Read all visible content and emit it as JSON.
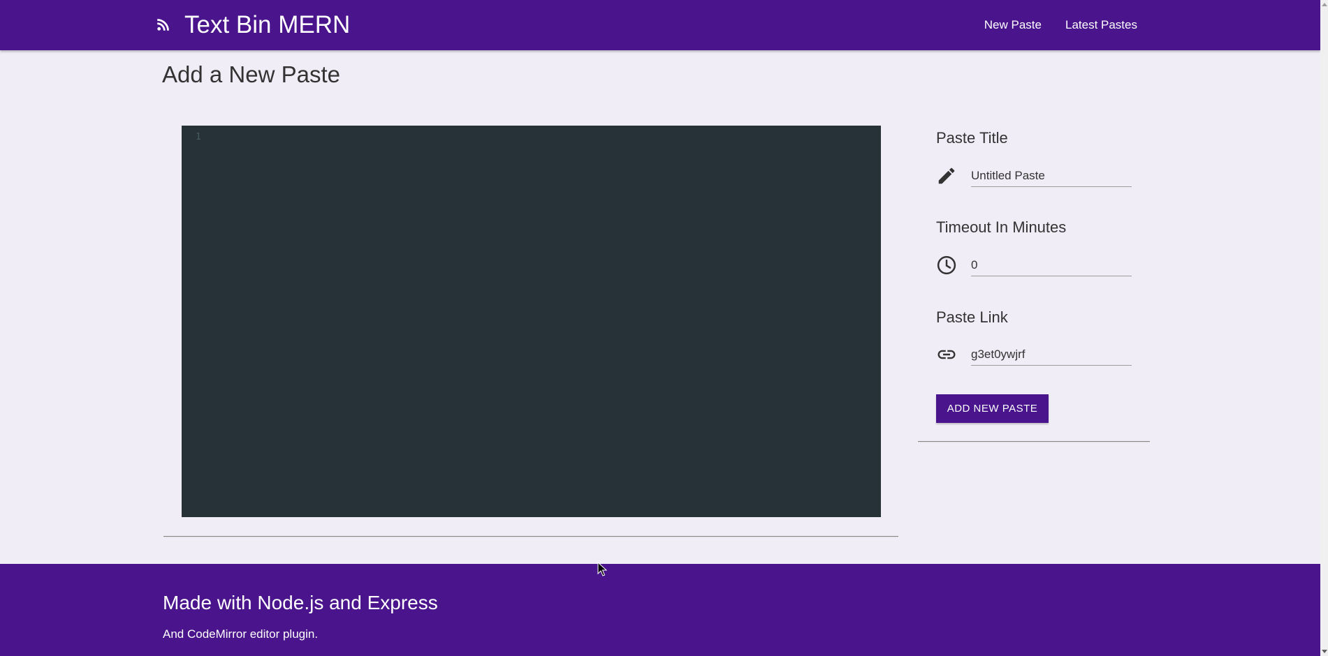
{
  "header": {
    "brand": "Text Bin MERN",
    "brand_icon": "rss-icon",
    "nav": [
      {
        "label": "New Paste"
      },
      {
        "label": "Latest Pastes"
      }
    ]
  },
  "main": {
    "title": "Add a New Paste",
    "editor": {
      "line_numbers": [
        "1"
      ],
      "content": ""
    }
  },
  "form": {
    "title": {
      "label": "Paste Title",
      "icon": "pencil-icon",
      "value": "Untitled Paste"
    },
    "timeout": {
      "label": "Timeout In Minutes",
      "icon": "clock-icon",
      "value": "0"
    },
    "link": {
      "label": "Paste Link",
      "icon": "link-icon",
      "value": "g3et0ywjrf"
    },
    "submit_label": "ADD NEW PASTE"
  },
  "footer": {
    "title": "Made with Node.js and Express",
    "subtitle": "And CodeMirror editor plugin."
  },
  "colors": {
    "primary": "#4a148c",
    "background": "#f0edf6",
    "editor_bg": "#263238"
  }
}
